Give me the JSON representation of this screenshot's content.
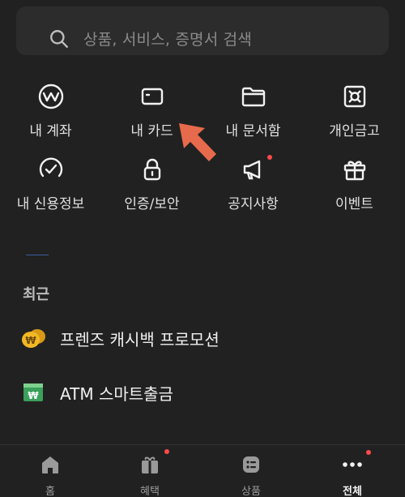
{
  "search": {
    "placeholder": "상품, 서비스, 증명서 검색",
    "icon": "search-icon"
  },
  "menu": [
    {
      "label": "내 계좌",
      "icon": "won-circle-icon"
    },
    {
      "label": "내 카드",
      "icon": "card-icon"
    },
    {
      "label": "내 문서함",
      "icon": "folder-icon"
    },
    {
      "label": "개인금고",
      "icon": "safe-icon"
    },
    {
      "label": "내 신용정보",
      "icon": "credit-gauge-icon"
    },
    {
      "label": "인증/보안",
      "icon": "lock-icon"
    },
    {
      "label": "공지사항",
      "icon": "megaphone-icon",
      "badge": true
    },
    {
      "label": "이벤트",
      "icon": "gift-icon"
    }
  ],
  "recent": {
    "title": "최근",
    "items": [
      {
        "label": "프렌즈 캐시백 프로모션",
        "icon": "coin-cashback-icon"
      },
      {
        "label": "ATM 스마트출금",
        "icon": "atm-icon"
      }
    ]
  },
  "tabs": [
    {
      "label": "홈",
      "icon": "home-icon",
      "active": false,
      "badge": false
    },
    {
      "label": "혜택",
      "icon": "benefit-gift-icon",
      "active": false,
      "badge": true
    },
    {
      "label": "상품",
      "icon": "product-icon",
      "active": false,
      "badge": false
    },
    {
      "label": "전체",
      "icon": "more-dots-icon",
      "active": true,
      "badge": true
    }
  ],
  "colors": {
    "background": "#212121",
    "badge": "#ff4a4a",
    "arrow": "#e86a4c",
    "coin": "#f2b724",
    "atm": "#3aa05a"
  }
}
